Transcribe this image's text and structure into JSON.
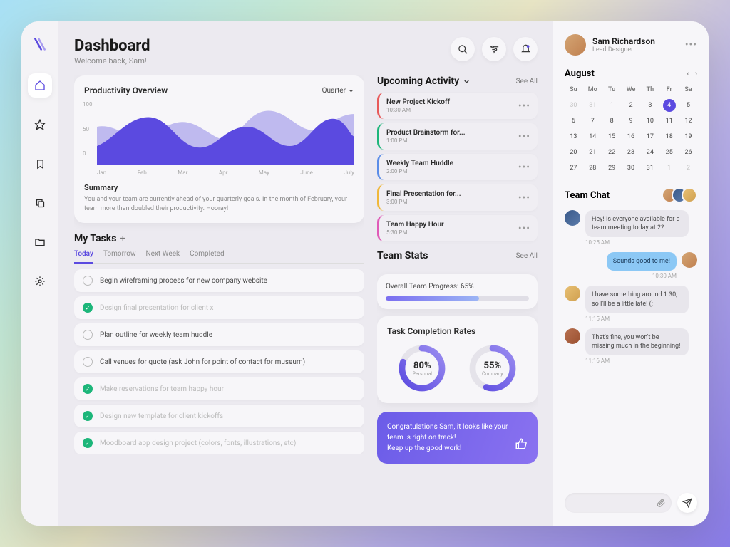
{
  "header": {
    "title": "Dashboard",
    "subtitle": "Welcome back, Sam!"
  },
  "nav": {
    "items": [
      "home",
      "star",
      "bookmark",
      "copy",
      "folder",
      "settings"
    ]
  },
  "productivity": {
    "title": "Productivity Overview",
    "period": "Quarter",
    "summary_title": "Summary",
    "summary_text": "You and your team are currently ahead of your quarterly goals. In the month of February, your team more than doubled their productivity. Hooray!"
  },
  "chart_data": {
    "type": "area",
    "title": "Productivity Overview",
    "xlabel": "",
    "ylabel": "",
    "ylim": [
      0,
      100
    ],
    "categories": [
      "Jan",
      "Feb",
      "Mar",
      "Apr",
      "May",
      "June",
      "July"
    ],
    "series": [
      {
        "name": "back",
        "values": [
          60,
          45,
          68,
          40,
          85,
          55,
          80
        ]
      },
      {
        "name": "front",
        "values": [
          30,
          75,
          28,
          60,
          30,
          72,
          45
        ]
      }
    ]
  },
  "my_tasks": {
    "title": "My Tasks",
    "tabs": [
      "Today",
      "Tomorrow",
      "Next Week",
      "Completed"
    ],
    "active_tab": "Today",
    "items": [
      {
        "text": "Begin wireframing process for new company website",
        "done": false
      },
      {
        "text": "Design final presentation for client x",
        "done": true
      },
      {
        "text": "Plan outline for weekly team huddle",
        "done": false
      },
      {
        "text": "Call venues for quote (ask John for point of contact for museum)",
        "done": false
      },
      {
        "text": "Make reservations for team happy hour",
        "done": true
      },
      {
        "text": "Design new template for client kickoffs",
        "done": true
      },
      {
        "text": "Moodboard app design project (colors, fonts, illustrations, etc)",
        "done": true
      }
    ]
  },
  "upcoming": {
    "title": "Upcoming Activity",
    "see_all": "See All",
    "items": [
      {
        "title": "New Project Kickoff",
        "time": "10:30 AM",
        "color": "#e85a5a"
      },
      {
        "title": "Product Brainstorm for...",
        "time": "1:00 PM",
        "color": "#1db67a"
      },
      {
        "title": "Weekly Team Huddle",
        "time": "2:00 PM",
        "color": "#5b8de8"
      },
      {
        "title": "Final Presentation for...",
        "time": "3:00 PM",
        "color": "#f0b83a"
      },
      {
        "title": "Team Happy Hour",
        "time": "5:30 PM",
        "color": "#e05ab8"
      }
    ]
  },
  "team_stats": {
    "title": "Team Stats",
    "see_all": "See All",
    "progress_label": "Overall Team Progress: 65%",
    "progress_pct": 65,
    "completion_title": "Task Completion Rates",
    "personal_pct": 80,
    "personal_label": "Personal",
    "company_pct": 55,
    "company_label": "Company"
  },
  "congrats": "Congratulations Sam, it looks like your team is right on track!\nKeep up the good work!",
  "profile": {
    "name": "Sam Richardson",
    "role": "Lead Designer"
  },
  "calendar": {
    "month": "August",
    "dow": [
      "Su",
      "Mo",
      "Tu",
      "We",
      "Th",
      "Fr",
      "Sa"
    ],
    "today": 4,
    "leading": [
      30,
      31
    ],
    "days": 31,
    "trailing": [
      1,
      2
    ]
  },
  "chat": {
    "title": "Team Chat",
    "messages": [
      {
        "text": "Hey! Is everyone available for a team meeting today at 2?",
        "time": "10:25 AM",
        "mine": false
      },
      {
        "text": "Sounds good to me!",
        "time": "10:30 AM",
        "mine": true
      },
      {
        "text": "I have something around 1:30, so I'll be a little late! (:",
        "time": "11:15 AM",
        "mine": false
      },
      {
        "text": "That's fine, you won't be missing much in the beginning!",
        "time": "11:16 AM",
        "mine": false
      }
    ]
  }
}
